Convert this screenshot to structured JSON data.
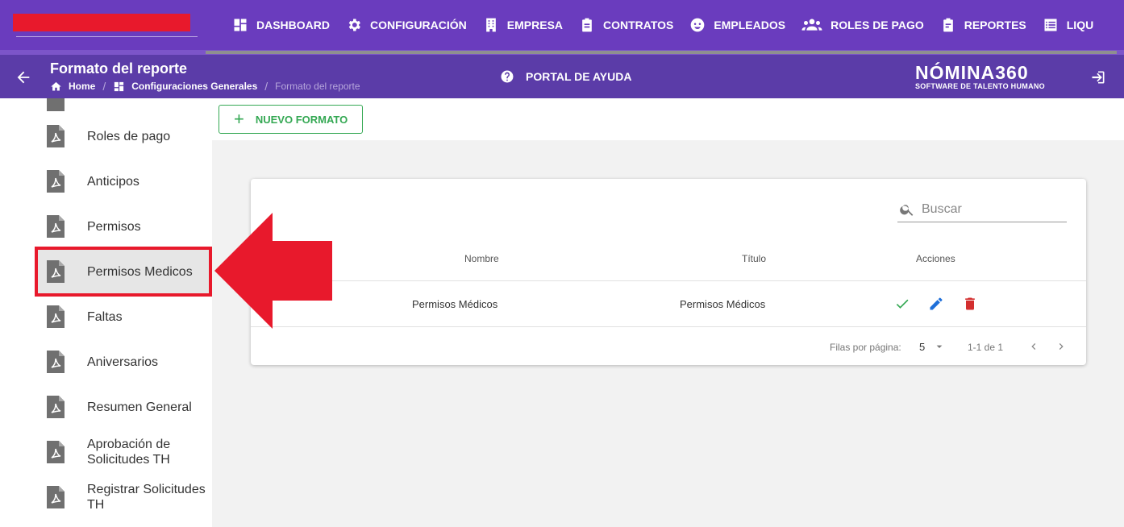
{
  "nav": {
    "items": [
      {
        "label": "DASHBOARD",
        "icon": "dashboard-icon"
      },
      {
        "label": "CONFIGURACIÓN",
        "icon": "gear-icon"
      },
      {
        "label": "EMPRESA",
        "icon": "building-icon"
      },
      {
        "label": "CONTRATOS",
        "icon": "clipboard-icon"
      },
      {
        "label": "EMPLEADOS",
        "icon": "face-icon"
      },
      {
        "label": "ROLES DE PAGO",
        "icon": "users-icon"
      },
      {
        "label": "REPORTES",
        "icon": "report-icon"
      },
      {
        "label": "LIQU",
        "icon": "list-icon"
      }
    ]
  },
  "header": {
    "title": "Formato del reporte",
    "breadcrumb": {
      "home": "Home",
      "section": "Configuraciones Generales",
      "current": "Formato del reporte",
      "separator": "/"
    },
    "help_label": "PORTAL DE AYUDA",
    "brand_name": "NÓMINA360",
    "brand_tagline": "SOFTWARE DE TALENTO HUMANO"
  },
  "sidebar": {
    "items": [
      {
        "label": "Roles de pago"
      },
      {
        "label": "Anticipos"
      },
      {
        "label": "Permisos"
      },
      {
        "label": "Permisos Medicos",
        "active": true
      },
      {
        "label": "Faltas"
      },
      {
        "label": "Aniversarios"
      },
      {
        "label": "Resumen General"
      },
      {
        "label": "Aprobación de Solicitudes TH"
      },
      {
        "label": "Registrar Solicitudes TH"
      }
    ]
  },
  "toolbar": {
    "new_button_label": "NUEVO FORMATO",
    "new_button_icon": "+"
  },
  "table": {
    "search_placeholder": "Buscar",
    "columns": {
      "nombre": "Nombre",
      "titulo": "Título",
      "acciones": "Acciones"
    },
    "rows": [
      {
        "nombre": "Permisos Médicos",
        "titulo": "Permisos Médicos"
      }
    ],
    "rows_per_page_label": "Filas por página:",
    "rows_per_page_value": "5",
    "range_label": "1-1 de 1"
  },
  "colors": {
    "nav_bg": "#6a3cbe",
    "subheader_bg": "#5b3ca8",
    "accent_green": "#34a853",
    "edit_blue": "#1e6fd9",
    "delete_red": "#d32f2f",
    "highlight_red": "#e8192c"
  }
}
